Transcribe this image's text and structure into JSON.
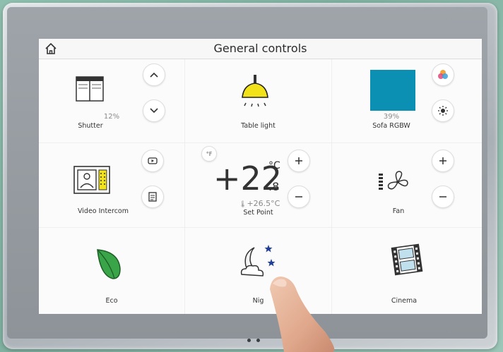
{
  "header": {
    "title": "General controls"
  },
  "tiles": {
    "shutter": {
      "pct": "12%",
      "label": "Shutter"
    },
    "table_light": {
      "label": "Table light"
    },
    "sofa": {
      "pct": "39%",
      "label": "Sofa RGBW",
      "color": "#0b8fb3"
    },
    "intercom": {
      "label": "Video Intercom"
    },
    "setpoint": {
      "unit_toggle": "°F",
      "temp_int": "+22",
      "temp_unit": "°C",
      "temp_dec": ".8",
      "setpoint_value": "+26.5°C",
      "label": "Set Point"
    },
    "fan": {
      "label": "Fan"
    },
    "eco": {
      "label": "Eco"
    },
    "night": {
      "label": "Nig"
    },
    "cinema": {
      "label": "Cinema"
    }
  },
  "colors": {
    "eco_leaf": "#3aa449",
    "lamp_yellow": "#f2e21a",
    "star_blue": "#1f3f99"
  }
}
